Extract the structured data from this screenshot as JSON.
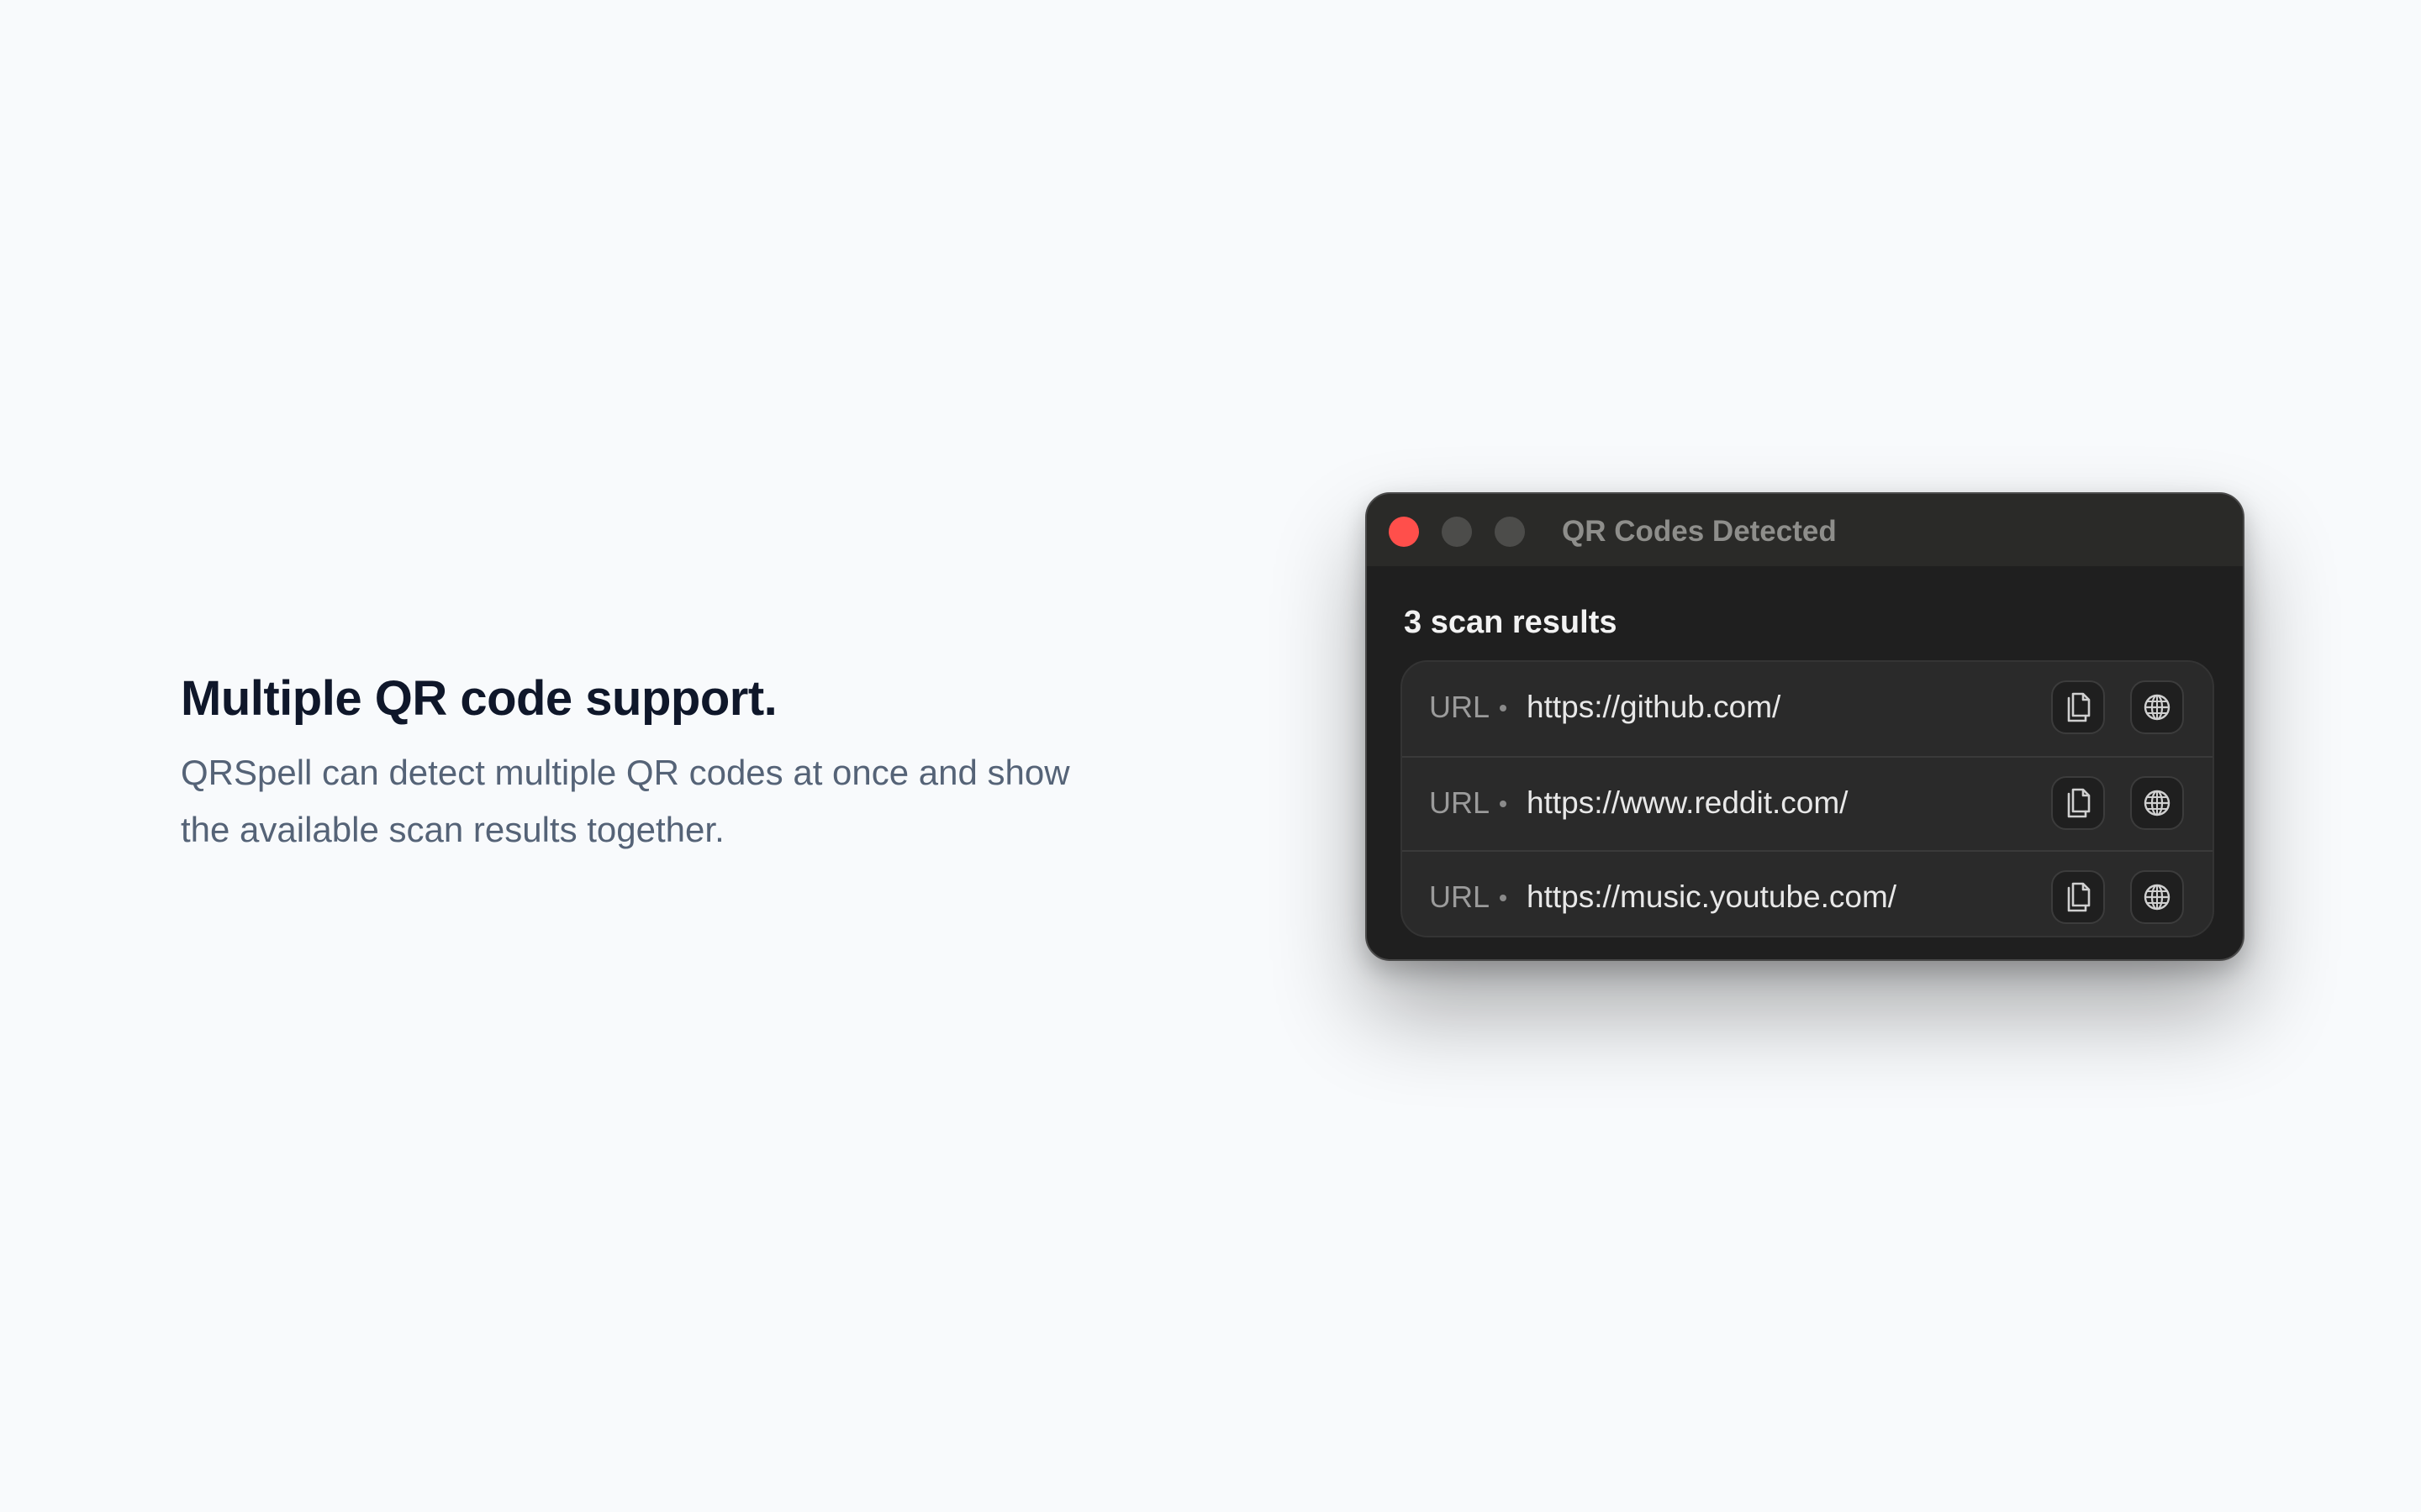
{
  "feature": {
    "heading": "Multiple QR code support.",
    "description_line1": "QRSpell can detect multiple QR codes at once and show",
    "description_line2": "the available scan results together."
  },
  "window": {
    "title": "QR Codes Detected",
    "traffic_lights": [
      "close",
      "minimize",
      "maximize"
    ],
    "scan_count": "3 scan results",
    "results": [
      {
        "type": "URL",
        "separator": "•",
        "value": "https://github.com/",
        "actions": [
          "copy-icon",
          "globe-icon"
        ]
      },
      {
        "type": "URL",
        "separator": "•",
        "value": "https://www.reddit.com/",
        "actions": [
          "copy-icon",
          "globe-icon"
        ]
      },
      {
        "type": "URL",
        "separator": "•",
        "value": "https://music.youtube.com/",
        "actions": [
          "copy-icon",
          "globe-icon"
        ]
      }
    ]
  },
  "colors": {
    "page_background": "#f8fafc",
    "heading": "#0f172a",
    "description": "#556377",
    "window_background": "#1f1f1f",
    "close_button": "#ff4f4b"
  }
}
